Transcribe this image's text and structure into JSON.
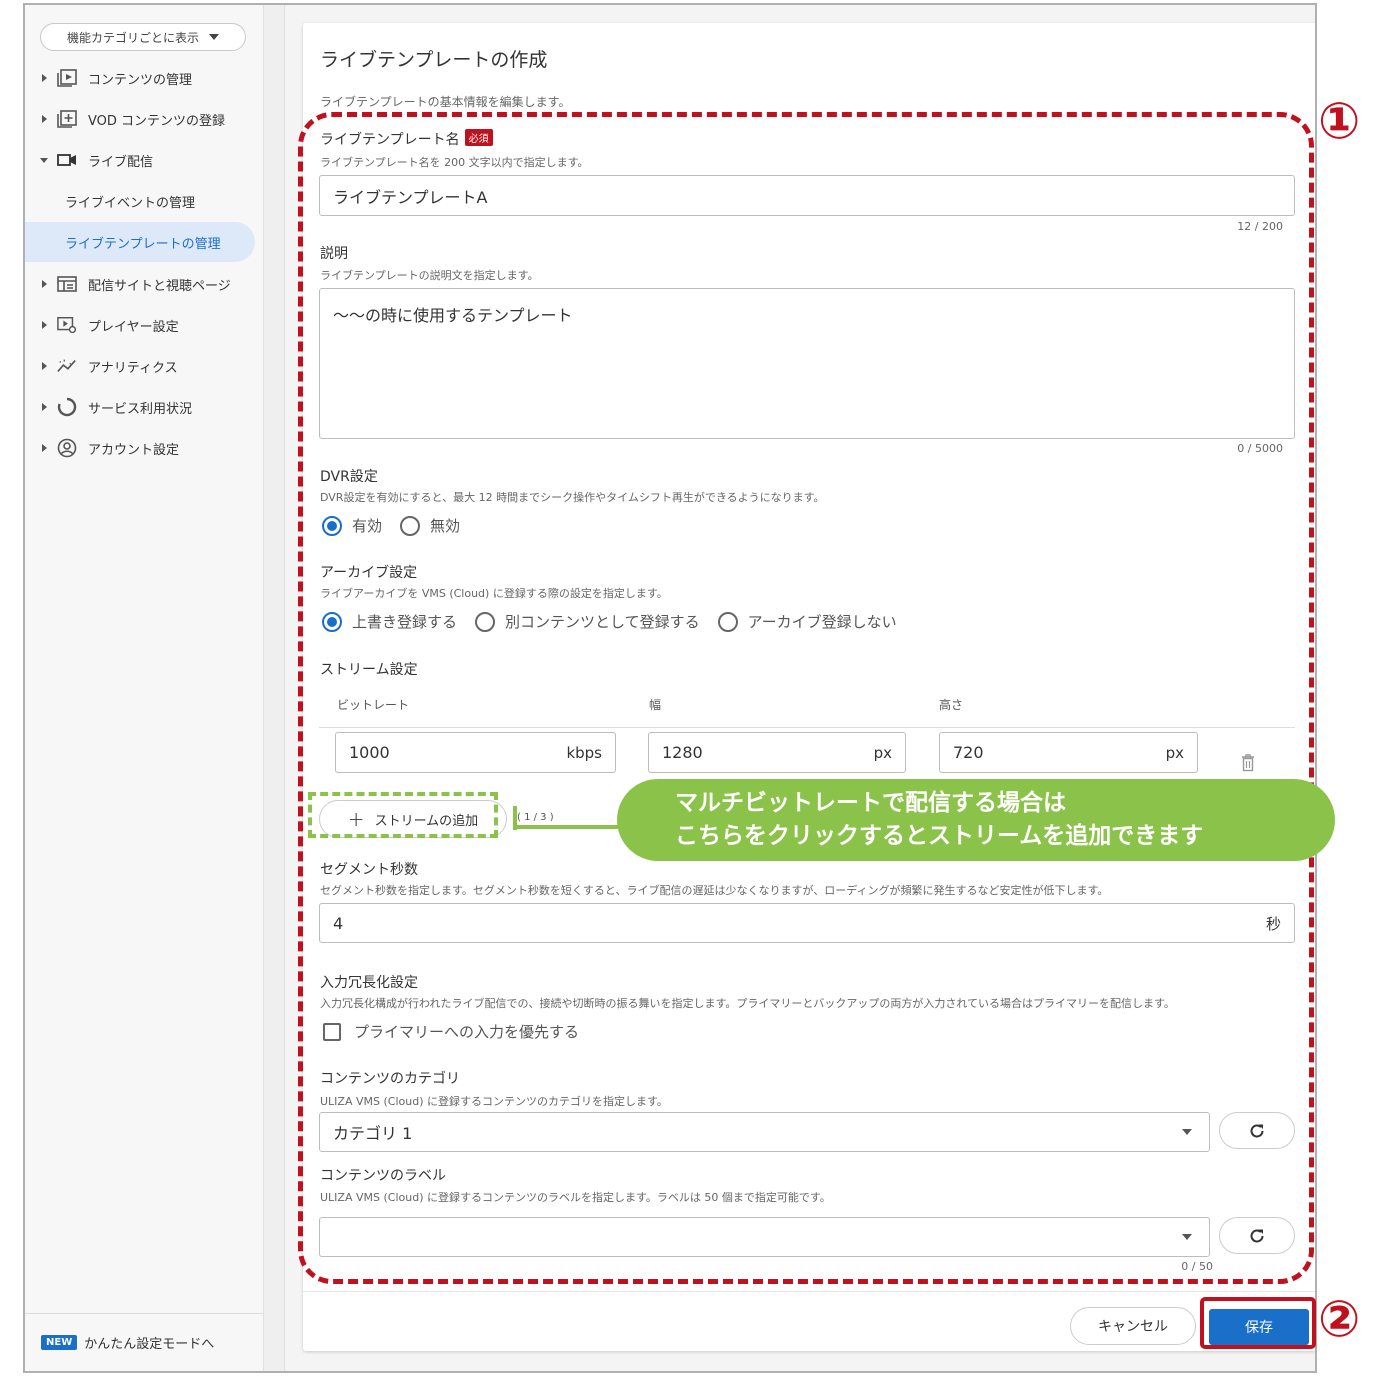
{
  "sidebar": {
    "category_select": "機能カテゴリごとに表示",
    "items": [
      {
        "label": "コンテンツの管理"
      },
      {
        "label": "VOD コンテンツの登録"
      },
      {
        "label": "ライブ配信"
      },
      {
        "label": "配信サイトと視聴ページ"
      },
      {
        "label": "プレイヤー設定"
      },
      {
        "label": "アナリティクス"
      },
      {
        "label": "サービス利用状況"
      },
      {
        "label": "アカウント設定"
      }
    ],
    "sub_items": [
      {
        "label": "ライブイベントの管理"
      },
      {
        "label": "ライブテンプレートの管理"
      }
    ],
    "new_badge": "NEW",
    "easy_mode": "かんたん設定モードへ"
  },
  "page": {
    "title": "ライブテンプレートの作成",
    "description": "ライブテンプレートの基本情報を編集します。"
  },
  "form": {
    "name": {
      "label": "ライブテンプレート名",
      "required": "必須",
      "hint": "ライブテンプレート名を 200 文字以内で指定します。",
      "value": "ライブテンプレートA",
      "counter": "12 / 200"
    },
    "desc": {
      "label": "説明",
      "hint": "ライブテンプレートの説明文を指定します。",
      "value": "〜〜の時に使用するテンプレート",
      "counter": "0 / 5000"
    },
    "dvr": {
      "label": "DVR設定",
      "hint": "DVR設定を有効にすると、最大 12 時間までシーク操作やタイムシフト再生ができるようになります。",
      "options": [
        "有効",
        "無効"
      ],
      "selected": "有効"
    },
    "archive": {
      "label": "アーカイブ設定",
      "hint": "ライブアーカイブを VMS (Cloud) に登録する際の設定を指定します。",
      "options": [
        "上書き登録する",
        "別コンテンツとして登録する",
        "アーカイブ登録しない"
      ],
      "selected": "上書き登録する"
    },
    "stream": {
      "label": "ストリーム設定",
      "columns": [
        "ビットレート",
        "幅",
        "高さ"
      ],
      "row": {
        "bitrate": "1000",
        "bitrate_unit": "kbps",
        "width": "1280",
        "width_unit": "px",
        "height": "720",
        "height_unit": "px"
      },
      "add_button": "ストリームの追加",
      "count": "( 1 / 3 )"
    },
    "segment": {
      "label": "セグメント秒数",
      "hint": "セグメント秒数を指定します。セグメント秒数を短くすると、ライブ配信の遅延は少なくなりますが、ローディングが頻繁に発生するなど安定性が低下します。",
      "value": "4",
      "unit": "秒"
    },
    "redundancy": {
      "label": "入力冗長化設定",
      "hint": "入力冗長化構成が行われたライブ配信での、接続や切断時の振る舞いを指定します。プライマリーとバックアップの両方が入力されている場合はプライマリーを配信します。",
      "checkbox": "プライマリーへの入力を優先する",
      "checked": false
    },
    "category": {
      "label": "コンテンツのカテゴリ",
      "hint": "ULIZA VMS (Cloud) に登録するコンテンツのカテゴリを指定します。",
      "value": "カテゴリ 1"
    },
    "labels": {
      "label": "コンテンツのラベル",
      "hint": "ULIZA VMS (Cloud) に登録するコンテンツのラベルを指定します。ラベルは 50 個まで指定可能です。",
      "value": "",
      "counter": "0 / 50"
    }
  },
  "actions": {
    "cancel": "キャンセル",
    "save": "保存"
  },
  "annotations": {
    "num1": "①",
    "num2": "②",
    "callout_line1": "マルチビットレートで配信する場合は",
    "callout_line2": "こちらをクリックするとストリームを追加できます"
  },
  "colors": {
    "accent": "#1a6fc9",
    "annotation_red": "#c0121e",
    "annotation_green": "#8bc34a"
  }
}
